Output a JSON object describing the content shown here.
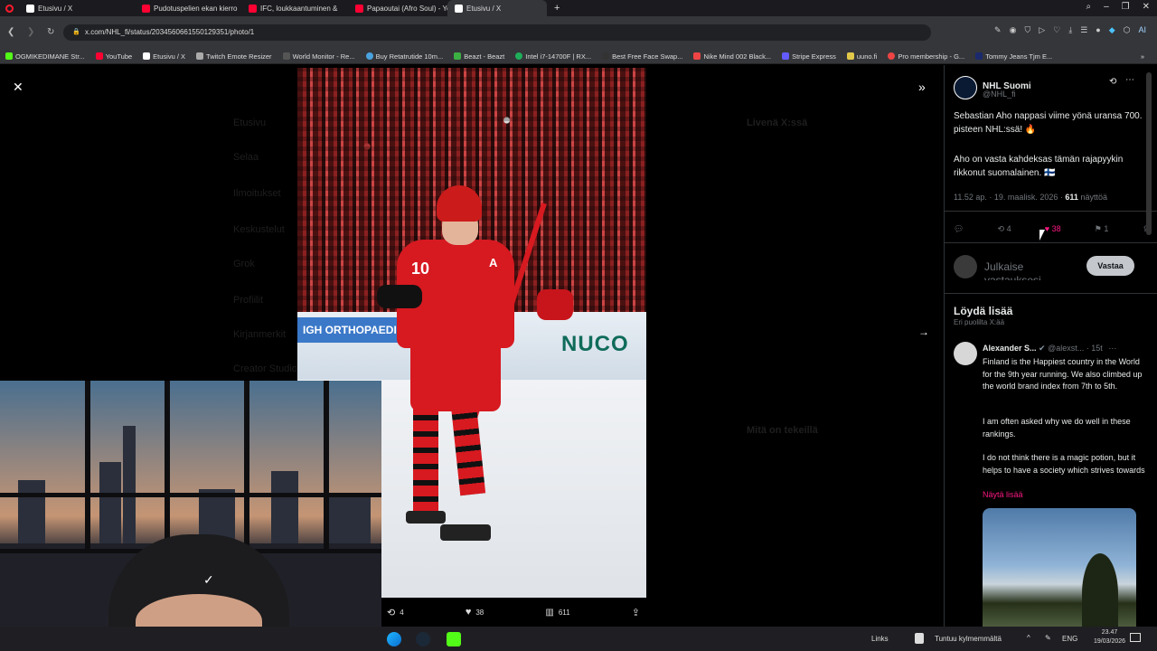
{
  "browser": {
    "tabs": [
      {
        "label": "Etusivu / X",
        "icon": "x-icon"
      },
      {
        "label": "Pudotuspelien ekan kierro",
        "icon": "youtube-icon"
      },
      {
        "label": "IFC, loukkaantuminen &",
        "icon": "youtube-icon"
      },
      {
        "label": "Papaoutai (Afro Soul) - Yo",
        "icon": "youtube-icon"
      },
      {
        "label": "Etusivu / X",
        "icon": "x-icon"
      }
    ],
    "url": "x.com/NHL_fi/status/2034560661550129351/photo/1",
    "bookmarks": [
      "OGMIKEDIMANE Str...",
      "YouTube",
      "Etusivu / X",
      "Twitch Emote Resizer",
      "World Monitor - Re...",
      "Buy Retatrutide 10m...",
      "Beazt - Beazt",
      "Intel i7-14700F | RX...",
      "Best Free Face Swap...",
      "Nike Mind 002 Black...",
      "Stripe Express",
      "uuno.fi",
      "Pro membership - G...",
      "Tommy Jeans Tjm E..."
    ],
    "ai_label": "AI"
  },
  "photo": {
    "board_text": "NUCO",
    "jersey_number": "10",
    "captain_letter": "A",
    "arena_text": "IGH ORTHOPAEDIC",
    "retweets": "4",
    "likes": "38",
    "views": "611"
  },
  "webcam": {
    "logo": "✓"
  },
  "tweet": {
    "author_name": "NHL Suomi",
    "author_handle": "@NHL_fi",
    "text_1": "Sebastian Aho nappasi viime yönä uransa 700. pisteen NHL:ssä! 🔥",
    "text_2": "Aho on vasta kahdeksas tämän rajapyykin rikkonut suomalainen. 🇫🇮",
    "meta_time": "11.52 ap. · 19. maalisk. 2026 · ",
    "meta_views_num": "611",
    "meta_views_label": " näyttöä",
    "retweets": "4",
    "likes": "38",
    "bookmarks": "1",
    "reply_placeholder": "Julkaise vastauksesi",
    "reply_button": "Vastaa"
  },
  "discover": {
    "title": "Löydä lisää",
    "subtitle": "Eri puolilta X:ää",
    "post": {
      "author_name": "Alexander S...",
      "author_handle": "@alexst...",
      "time": "· 15t",
      "para_1": "Finland is the Happiest country in the World for the 9th year running. We also climbed up the world brand index from 7th to 5th.",
      "para_2": "I am often asked why we do well in these rankings.",
      "para_3": "I do not think there is a magic potion, but it helps to have a society which strives towards",
      "show_more": "Näytä lisää"
    }
  },
  "background_feed": {
    "nav": [
      "Etusivu",
      "Selaa",
      "Ilmoitukset",
      "Keskustelut",
      "Grok",
      "Profiilit",
      "Kirjanmerkit",
      "Creator Studio"
    ],
    "trending_title": "Livenä X:ssä",
    "whats_happening": "Mitä on tekeillä"
  },
  "taskbar": {
    "links": "Links",
    "weather": "Tuntuu kylmemmältä",
    "lang": "ENG",
    "time": "23.47",
    "date": "19/03/2026"
  }
}
